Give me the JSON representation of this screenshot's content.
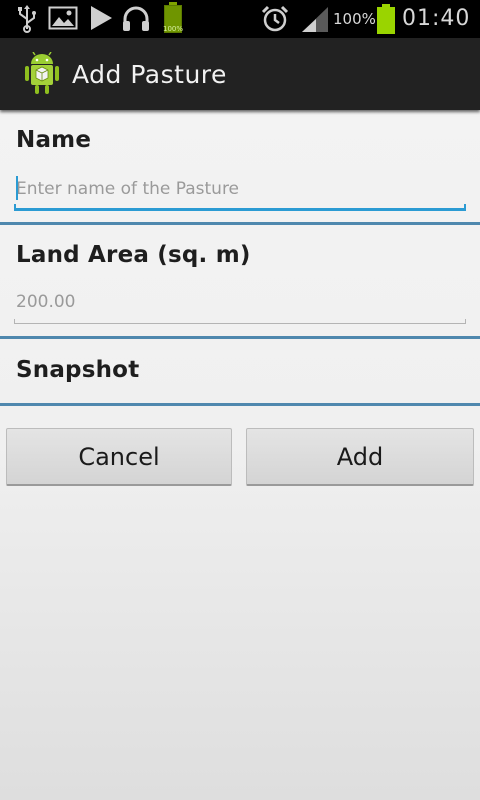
{
  "status_bar": {
    "battery_left_label": "100%",
    "signal_percent": "100%",
    "time": "01:40",
    "icons": [
      "usb-icon",
      "image-icon",
      "play-icon",
      "headphones-icon",
      "battery-charging-icon",
      "alarm-icon",
      "signal-icon",
      "battery-icon"
    ]
  },
  "action_bar": {
    "title": "Add Pasture",
    "icon": "android-app-icon"
  },
  "form": {
    "name": {
      "label": "Name",
      "value": "",
      "placeholder": "Enter name of the Pasture"
    },
    "land_area": {
      "label": "Land Area (sq. m)",
      "value": "",
      "placeholder": "200.00"
    },
    "snapshot": {
      "label": "Snapshot"
    }
  },
  "buttons": {
    "cancel_label": "Cancel",
    "add_label": "Add"
  },
  "colors": {
    "status_bar_bg": "#000000",
    "action_bar_bg": "#222222",
    "focus_accent": "#2b9bd3",
    "divider": "#4f88ae",
    "battery_green": "#9ad400"
  }
}
